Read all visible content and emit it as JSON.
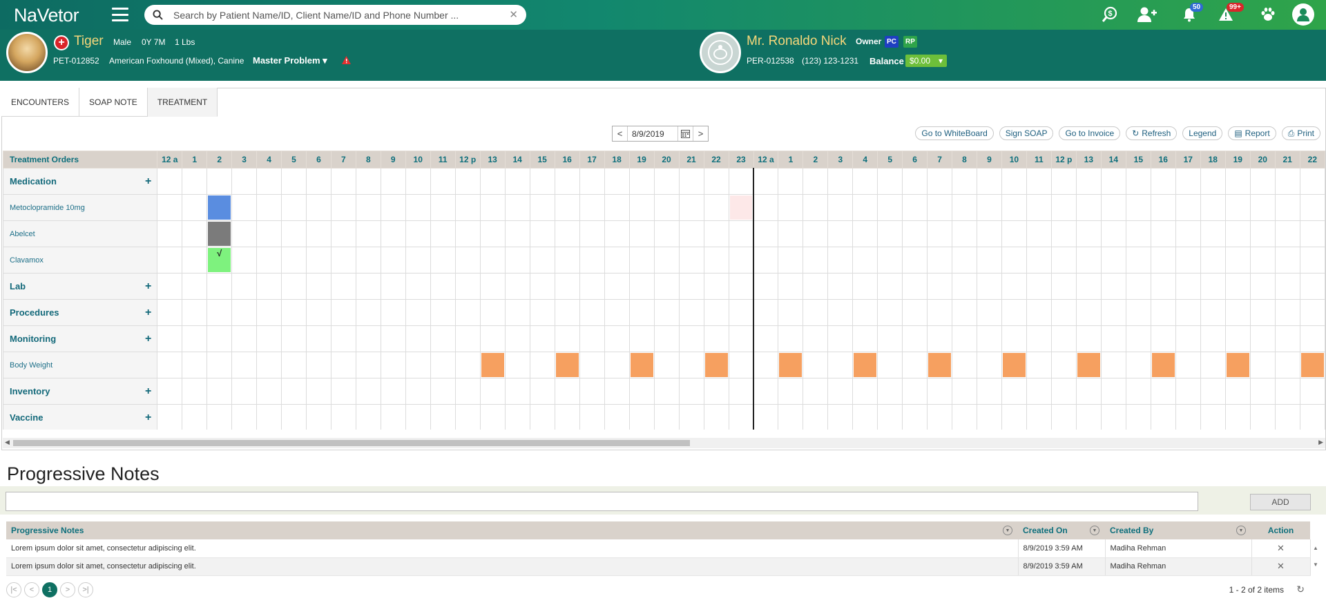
{
  "app": {
    "logo": "NaVetor",
    "search_placeholder": "Search by Patient Name/ID, Client Name/ID and Phone Number ...",
    "badges": {
      "notifications": "50",
      "alerts": "99+"
    }
  },
  "patient": {
    "name": "Tiger",
    "sex": "Male",
    "age": "0Y 7M",
    "weight": "1 Lbs",
    "id": "PET-012852",
    "breed": "American Foxhound (Mixed), Canine",
    "master_problem": "Master Problem"
  },
  "owner": {
    "name": "Mr. Ronaldo Nick",
    "owner_label": "Owner",
    "chips": [
      "PC",
      "RP"
    ],
    "id": "PER-012538",
    "phone": "(123) 123-1231",
    "balance_label": "Balance",
    "balance": "$0.00"
  },
  "tabs": [
    "ENCOUNTERS",
    "SOAP NOTE",
    "TREATMENT"
  ],
  "toolbar": {
    "date": "8/9/2019",
    "prev": "<",
    "next": ">",
    "buttons": [
      "Go to WhiteBoard",
      "Sign SOAP",
      "Go to Invoice",
      "Refresh",
      "Legend",
      "Report",
      "Print"
    ]
  },
  "grid": {
    "header_label": "Treatment Orders",
    "hours": [
      "12 a",
      "1",
      "2",
      "3",
      "4",
      "5",
      "6",
      "7",
      "8",
      "9",
      "10",
      "11",
      "12 p",
      "13",
      "14",
      "15",
      "16",
      "17",
      "18",
      "19",
      "20",
      "21",
      "22",
      "23",
      "12 a",
      "1",
      "2",
      "3",
      "4",
      "5",
      "6",
      "7",
      "8",
      "9",
      "10",
      "11",
      "12 p",
      "13",
      "14",
      "15",
      "16",
      "17",
      "18",
      "19",
      "20",
      "21",
      "22"
    ],
    "rows": [
      {
        "label": "Medication",
        "category": true,
        "plus": "+"
      },
      {
        "label": "Metoclopramide 10mg",
        "category": false
      },
      {
        "label": "Abelcet",
        "category": false
      },
      {
        "label": "Clavamox",
        "category": false
      },
      {
        "label": "Lab",
        "category": true,
        "plus": "+"
      },
      {
        "label": "Procedures",
        "category": true,
        "plus": "+"
      },
      {
        "label": "Monitoring",
        "category": true,
        "plus": "+"
      },
      {
        "label": "Body Weight",
        "category": false
      },
      {
        "label": "Inventory",
        "category": true,
        "plus": "+"
      },
      {
        "label": "Vaccine",
        "category": true,
        "plus": "+"
      }
    ],
    "colors": {
      "scheduled": "#5a8de0",
      "missed": "#7b7b7b",
      "done": "#7ef27e",
      "monitor": "#f6a060",
      "pending": "#fde8e8"
    },
    "cells": [
      {
        "row": 1,
        "col": 2,
        "status": "scheduled"
      },
      {
        "row": 1,
        "col": 23,
        "status": "pending"
      },
      {
        "row": 2,
        "col": 2,
        "status": "missed"
      },
      {
        "row": 3,
        "col": 2,
        "status": "done",
        "mark": "√"
      },
      {
        "row": 7,
        "col": 13,
        "status": "monitor"
      },
      {
        "row": 7,
        "col": 16,
        "status": "monitor"
      },
      {
        "row": 7,
        "col": 19,
        "status": "monitor"
      },
      {
        "row": 7,
        "col": 22,
        "status": "monitor"
      },
      {
        "row": 7,
        "col": 25,
        "status": "monitor"
      },
      {
        "row": 7,
        "col": 28,
        "status": "monitor"
      },
      {
        "row": 7,
        "col": 31,
        "status": "monitor"
      },
      {
        "row": 7,
        "col": 34,
        "status": "monitor"
      },
      {
        "row": 7,
        "col": 37,
        "status": "monitor"
      },
      {
        "row": 7,
        "col": 40,
        "status": "monitor"
      },
      {
        "row": 7,
        "col": 43,
        "status": "monitor"
      },
      {
        "row": 7,
        "col": 46,
        "status": "monitor"
      }
    ]
  },
  "progressive": {
    "title": "Progressive Notes",
    "add_label": "ADD",
    "columns": [
      "Progressive Notes",
      "Created On",
      "Created By",
      "Action"
    ],
    "rows": [
      {
        "note": "Lorem ipsum dolor sit amet, consectetur adipiscing elit.",
        "created_on": "8/9/2019 3:59 AM",
        "created_by": "Madiha Rehman",
        "action": "✕"
      },
      {
        "note": "Lorem ipsum dolor sit amet, consectetur adipiscing elit.",
        "created_on": "8/9/2019 3:59 AM",
        "created_by": "Madiha Rehman",
        "action": "✕"
      }
    ],
    "pager": {
      "first": "|<",
      "prev": "<",
      "page": "1",
      "next": ">",
      "last": ">|",
      "count": "1 - 2 of 2 items"
    }
  }
}
